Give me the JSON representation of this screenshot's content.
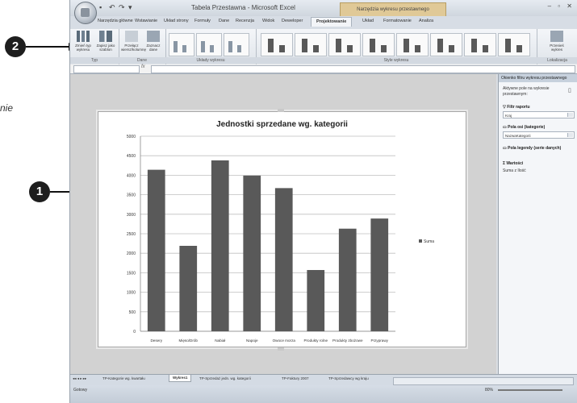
{
  "callouts": [
    "1",
    "2"
  ],
  "cut_text": "nie",
  "excel": {
    "title": "Tabela Przestawna - Microsoft Excel",
    "tools_context": "Narzędzia wykresu przestawnego",
    "tabs": [
      "Narzędzia główne",
      "Wstawianie",
      "Układ strony",
      "Formuły",
      "Dane",
      "Recenzja",
      "Widok",
      "Deweloper",
      "Projektowanie",
      "Układ",
      "Formatowanie",
      "Analiza"
    ],
    "active_tab": "Projektowanie",
    "ribbon": {
      "type_group": {
        "label": "Typ",
        "buttons": [
          "Zmień typ wykresu",
          "Zapisz jako szablon"
        ]
      },
      "data_group": {
        "label": "Dane",
        "buttons": [
          "Przełącz wiersz/kolumnę",
          "Zaznacz dane"
        ]
      },
      "layout_group": {
        "label": "Układy wykresu"
      },
      "styles_group": {
        "label": "Style wykresu"
      },
      "location_group": {
        "label": "Lokalizacja",
        "buttons": [
          "Przenieś wykres"
        ]
      }
    },
    "formula_bar": {
      "fx": "fx"
    },
    "chart": {
      "title": "Jednostki sprzedane wg. kategorii",
      "legend": "Suma"
    },
    "pane": {
      "header": "Okienko filtru wykresu przestawnego",
      "description": "Aktywne pole na wykresie przestawnym:",
      "report_filter_label": "Filtr raportu",
      "report_filter_value": "Kraj",
      "axis_fields_label": "Pola osi (kategorie)",
      "axis_fields_value": "NazwaKategorii",
      "legend_fields_label": "Pola legendy (serie danych)",
      "values_label": "Wartości",
      "values_value": "Suma z Ilość"
    },
    "sheet_tabs": [
      "TP-Kategorie wg. kwartału",
      "Wykres1",
      "TP-Sprzedaż jedn. wg. kategorii",
      "TP-Faktury 2007",
      "TP-Sprzedawcy wg kraju"
    ],
    "active_sheet": "Wykres1",
    "status": "Gotowy",
    "zoom": "80%"
  },
  "chart_data": {
    "type": "bar",
    "title": "Jednostki sprzedane wg. kategorii",
    "categories": [
      "Desery",
      "Mięso/Drób",
      "Nabiał",
      "Napoje",
      "Owoce morza",
      "Produkty rolne",
      "Produkty zbożowe",
      "Przyprawy"
    ],
    "series": [
      {
        "name": "Suma",
        "values": [
          4140,
          2190,
          4380,
          3990,
          3670,
          1570,
          2630,
          2890
        ]
      }
    ],
    "ylim": [
      0,
      5000
    ],
    "yticks": [
      0,
      500,
      1000,
      1500,
      2000,
      2500,
      3000,
      3500,
      4000,
      4500,
      5000
    ],
    "grid": true,
    "legend_position": "right",
    "bar_color": "#595959"
  }
}
